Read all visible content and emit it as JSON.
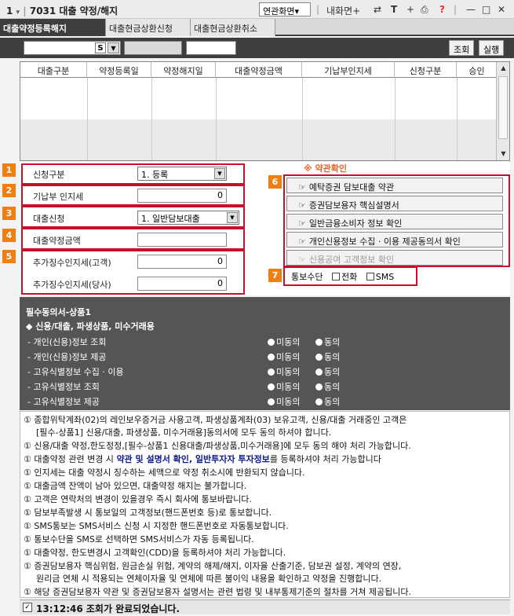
{
  "title": {
    "screen_no": "1",
    "text": "7031 대출 약정/해지",
    "related": "연관화면",
    "related_arrow": "▾",
    "mine": "내화면+",
    "help": "?"
  },
  "tabs": [
    "대출약정등록해지",
    "대출현금상환신청",
    "대출현금상환취소"
  ],
  "search": {
    "s_label": "S",
    "inquiry": "조회",
    "execute": "실행"
  },
  "grid": {
    "columns": [
      "대출구분",
      "약정등록일",
      "약정해지일",
      "대출약정금액",
      "기납부인지세",
      "신청구분",
      "승인"
    ]
  },
  "form": {
    "badges": [
      "1",
      "2",
      "3",
      "4",
      "5",
      "6",
      "7"
    ],
    "apply_type_label": "신청구분",
    "apply_type_value": "1. 등록",
    "paid_stamp_label": "기납부 인지세",
    "paid_stamp_value": "0",
    "loan_apply_label": "대출신청",
    "loan_apply_value": "1. 일반담보대출",
    "loan_amount_label": "대출약정금액",
    "loan_amount_value": "",
    "extra_stamp_customer_label": "추가징수인지세(고객)",
    "extra_stamp_customer_value": "0",
    "extra_stamp_company_label": "추가징수인지세(당사)",
    "extra_stamp_company_value": "0"
  },
  "agreement": {
    "warn": "※ 약관확인",
    "buttons": [
      "예탁증권 담보대출 약관",
      "증권담보용자 핵심설명서",
      "일반금융소비자 정보 확인",
      "개인신용정보 수집 · 이용 제공동의서 확인",
      "신용공여 고객정보 확인"
    ],
    "notify_label": "통보수단",
    "notify_phone": "전화",
    "notify_sms": "SMS"
  },
  "consent": {
    "title": "필수동의서-상품1",
    "subtitle": "◆ 신용/대출, 파생상품, 미수거래용",
    "rows": [
      "- 개인(신용)정보 조회",
      "- 개인(신용)정보 제공",
      "- 고유식별정보 수집 · 이용",
      "- 고유식별정보 조회",
      "- 고유식별정보 제공"
    ],
    "option_no": "미동의",
    "option_yes": "동의"
  },
  "notes": {
    "n1a": "① 종합위탁계좌(02)의 레인보우증거금 사용고객, 파생상품계좌(03) 보유고객, 신용/대출 거래중인 고객은",
    "n1b": "[필수-상품1] 신용/대출, 파생상품, 미수거래용]동의서에 모두 동의 하셔야 합니다.",
    "n2": "① 신용/대출 약정,한도정정,[필수-상품1 신용대출/파생상품,미수거래용]에 모두 동의 해야 처리 가능합니다.",
    "n3_pre": "① 대출약정 관련 변경 시 ",
    "n3_bold": "약관 및 설명서 확인, 일반투자자 투자정보",
    "n3_post": "를 등록하셔야 처리 가능합니다",
    "n4": "① 인지세는 대출 약정시 징수하는 세액으로 약정 취소시에 반환되지 않습니다.",
    "n5": "① 대출금액 잔액이 남아 있으면, 대출약정 해지는 불가합니다.",
    "n6": "① 고객은 연락처의 변경이 있을경우 즉시 회사에 통보바랍니다.",
    "n7": "① 담보부족발생 시 통보일의 고객정보(핸드폰번호 등)로 통보합니다.",
    "n8": "① SMS통보는 SMS서비스 신청 시 지정한 핸드폰번호로 자동통보합니다.",
    "n9": "① 통보수단을 SMS로 선택하면 SMS서비스가 자동 등록됩니다.",
    "n10": "① 대출약정, 한도변경시 고객확인(CDD)을 등록하셔야 처리 가능합니다.",
    "n11a": "① 증권담보용자 핵심위험, 원금손실 위험, 계약의 해제/해지, 이자율 산출기준, 담보권 설정, 계약의 연장,",
    "n11b": "원리금 연체 시 적용되는 연체이자율 및 연체에 따른 불이익 내용을 확인하고 약정을 진행합니다.",
    "n12": "① 해당 증권담보용자 약관 및 증권담보용자 설명서는 관련 법령 및 내부통제기준의 절차를 거쳐 제공됩니다."
  },
  "status": {
    "check": "✓",
    "text": "13:12:46  조회가 완료되었습니다."
  }
}
